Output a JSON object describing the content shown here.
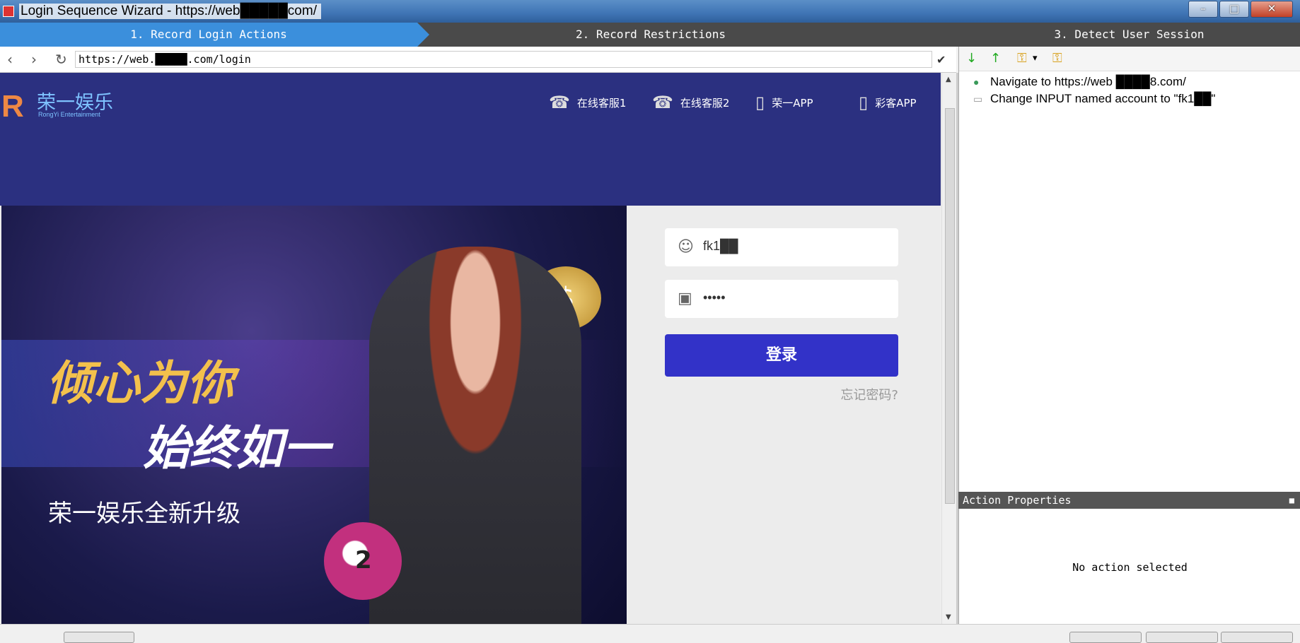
{
  "window": {
    "title": "Login Sequence Wizard - https://web█████com/",
    "controls": [
      "–",
      "□",
      "✕"
    ]
  },
  "steps": [
    {
      "label": "1. Record Login Actions",
      "active": true
    },
    {
      "label": "2. Record Restrictions",
      "active": false
    },
    {
      "label": "3. Detect User Session",
      "active": false
    }
  ],
  "browser": {
    "url": "https://web.█████.com/login",
    "back": "‹",
    "forward": "›",
    "refresh": "↻",
    "go": "✔"
  },
  "site": {
    "logo_name": "荣一娱乐",
    "logo_sub": "RongYi Entertainment",
    "top_links": [
      {
        "icon": "headset-icon",
        "glyph": "☎",
        "label": "在线客服1"
      },
      {
        "icon": "headset-icon",
        "glyph": "☎",
        "label": "在线客服2"
      },
      {
        "icon": "phone-icon",
        "glyph": "▯",
        "label": "荣一APP"
      },
      {
        "icon": "phone-icon",
        "glyph": "▯",
        "label": "彩客APP"
      }
    ],
    "banner": {
      "line1": "倾心为你",
      "line2": "始终如一",
      "line3": "荣一娱乐全新升级",
      "coin": "$",
      "ball": "2"
    },
    "login": {
      "username_value": "fk1██",
      "password_value": "•••••",
      "user_glyph": "☺",
      "lock_glyph": "▣",
      "submit_label": "登录",
      "forgot_label": "忘记密码?"
    }
  },
  "actions_toolbar": [
    "↓",
    "↑",
    "⚿",
    "▾",
    "⚿"
  ],
  "actions": [
    {
      "icon": "globe-icon",
      "glyph": "●",
      "label": "Navigate to https://web ████8.com/"
    },
    {
      "icon": "input-icon",
      "glyph": "▭",
      "label": "Change INPUT named account to \"fk1██\""
    }
  ],
  "properties": {
    "title": "Action Properties",
    "pin": "■",
    "empty_text": "No action selected"
  },
  "colors": {
    "active_step": "#3b8fdc",
    "site_header": "#2b3080",
    "login_button": "#3232c8"
  }
}
